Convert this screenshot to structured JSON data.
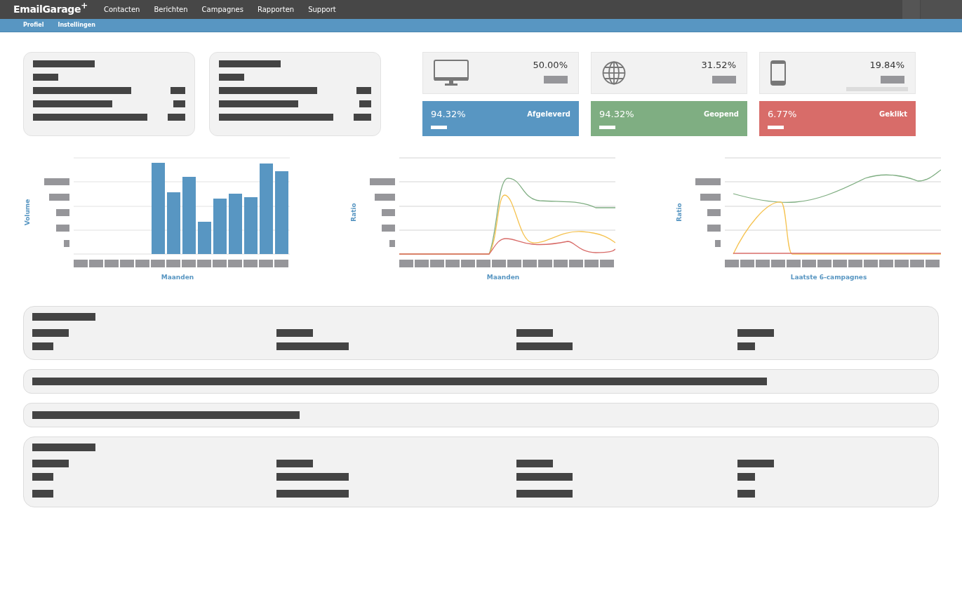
{
  "app": {
    "logo": "EmailGarage",
    "logo_mark": "+"
  },
  "nav": [
    {
      "label": "Contacten"
    },
    {
      "label": "Berichten"
    },
    {
      "label": "Campagnes"
    },
    {
      "label": "Rapporten"
    },
    {
      "label": "Support"
    }
  ],
  "subnav": [
    {
      "label": "Profiel"
    },
    {
      "label": "Instellingen"
    }
  ],
  "devices": [
    {
      "kind": "desktop",
      "reading": "50.00%"
    },
    {
      "kind": "web",
      "reading": "31.52%"
    },
    {
      "kind": "mobile",
      "reading": "19.84%"
    }
  ],
  "metrics": [
    {
      "title": "Afgeleverd",
      "rate": "94.32%",
      "color": "#5896c2"
    },
    {
      "title": "Geopend",
      "rate": "94.32%",
      "color": "#7fae82"
    },
    {
      "title": "Geklikt",
      "rate": "6.77%",
      "color": "#d86c69"
    }
  ],
  "charts": [
    {
      "kind": "bar",
      "ylabel": "Volume",
      "xlabel": "Maanden"
    },
    {
      "kind": "line",
      "ylabel": "Ratio",
      "xlabel": "Maanden"
    },
    {
      "kind": "campaign",
      "ylabel": "Ratio",
      "xlabel": "Laatste 6-campagnes"
    }
  ]
}
